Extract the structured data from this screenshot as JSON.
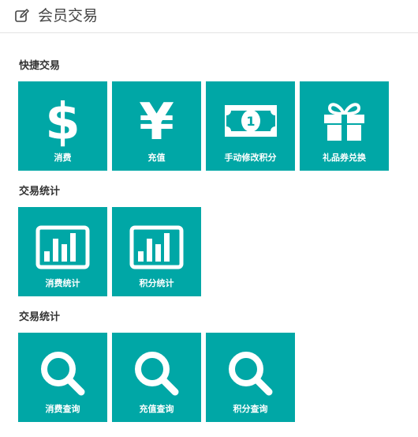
{
  "header": {
    "title": "会员交易",
    "icon": "edit-icon"
  },
  "sections": [
    {
      "title": "快捷交易",
      "tiles": [
        {
          "label": "消费",
          "icon": "dollar-icon"
        },
        {
          "label": "充值",
          "icon": "yen-icon"
        },
        {
          "label": "手动修改积分",
          "icon": "banknote-icon"
        },
        {
          "label": "礼品券兑换",
          "icon": "gift-icon"
        }
      ]
    },
    {
      "title": "交易统计",
      "tiles": [
        {
          "label": "消费统计",
          "icon": "bar-chart-icon"
        },
        {
          "label": "积分统计",
          "icon": "bar-chart-icon"
        }
      ]
    },
    {
      "title": "交易统计",
      "tiles": [
        {
          "label": "消费查询",
          "icon": "search-icon"
        },
        {
          "label": "充值查询",
          "icon": "search-icon"
        },
        {
          "label": "积分查询",
          "icon": "search-icon"
        }
      ]
    }
  ],
  "colors": {
    "tile": "#00a7a6",
    "text_on_tile": "#ffffff"
  }
}
